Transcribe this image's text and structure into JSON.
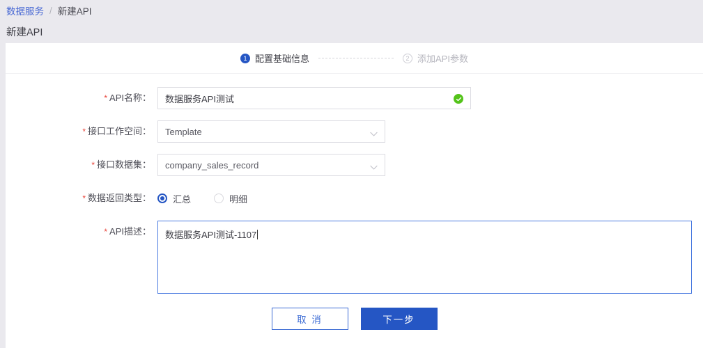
{
  "breadcrumb": {
    "root": "数据服务",
    "separator": "/",
    "current": "新建API"
  },
  "page_title": "新建API",
  "steps": [
    {
      "number": "1",
      "label": "配置基础信息",
      "state": "active"
    },
    {
      "number": "2",
      "label": "添加API参数",
      "state": "inactive"
    }
  ],
  "form": {
    "required_marker": "*",
    "api_name": {
      "label": "API名称：",
      "value": "数据服务API测试",
      "valid_icon": "check-circle-icon"
    },
    "workspace": {
      "label": "接口工作空间：",
      "value": "Template",
      "icon": "chevron-down-icon"
    },
    "dataset": {
      "label": "接口数据集：",
      "value": "company_sales_record",
      "icon": "chevron-down-icon"
    },
    "return_type": {
      "label": "数据返回类型：",
      "options": [
        {
          "label": "汇总",
          "checked": true
        },
        {
          "label": "明细",
          "checked": false
        }
      ]
    },
    "description": {
      "label": "API描述：",
      "value": "数据服务API测试-1107"
    }
  },
  "footer": {
    "cancel_label": "取 消",
    "next_label": "下一步"
  },
  "colors": {
    "primary": "#2556c4",
    "link": "#4a6ad4",
    "required": "#e8443a",
    "success": "#54c31a",
    "page_background": "#eae9ee",
    "focus_border": "#4a7ae0"
  }
}
